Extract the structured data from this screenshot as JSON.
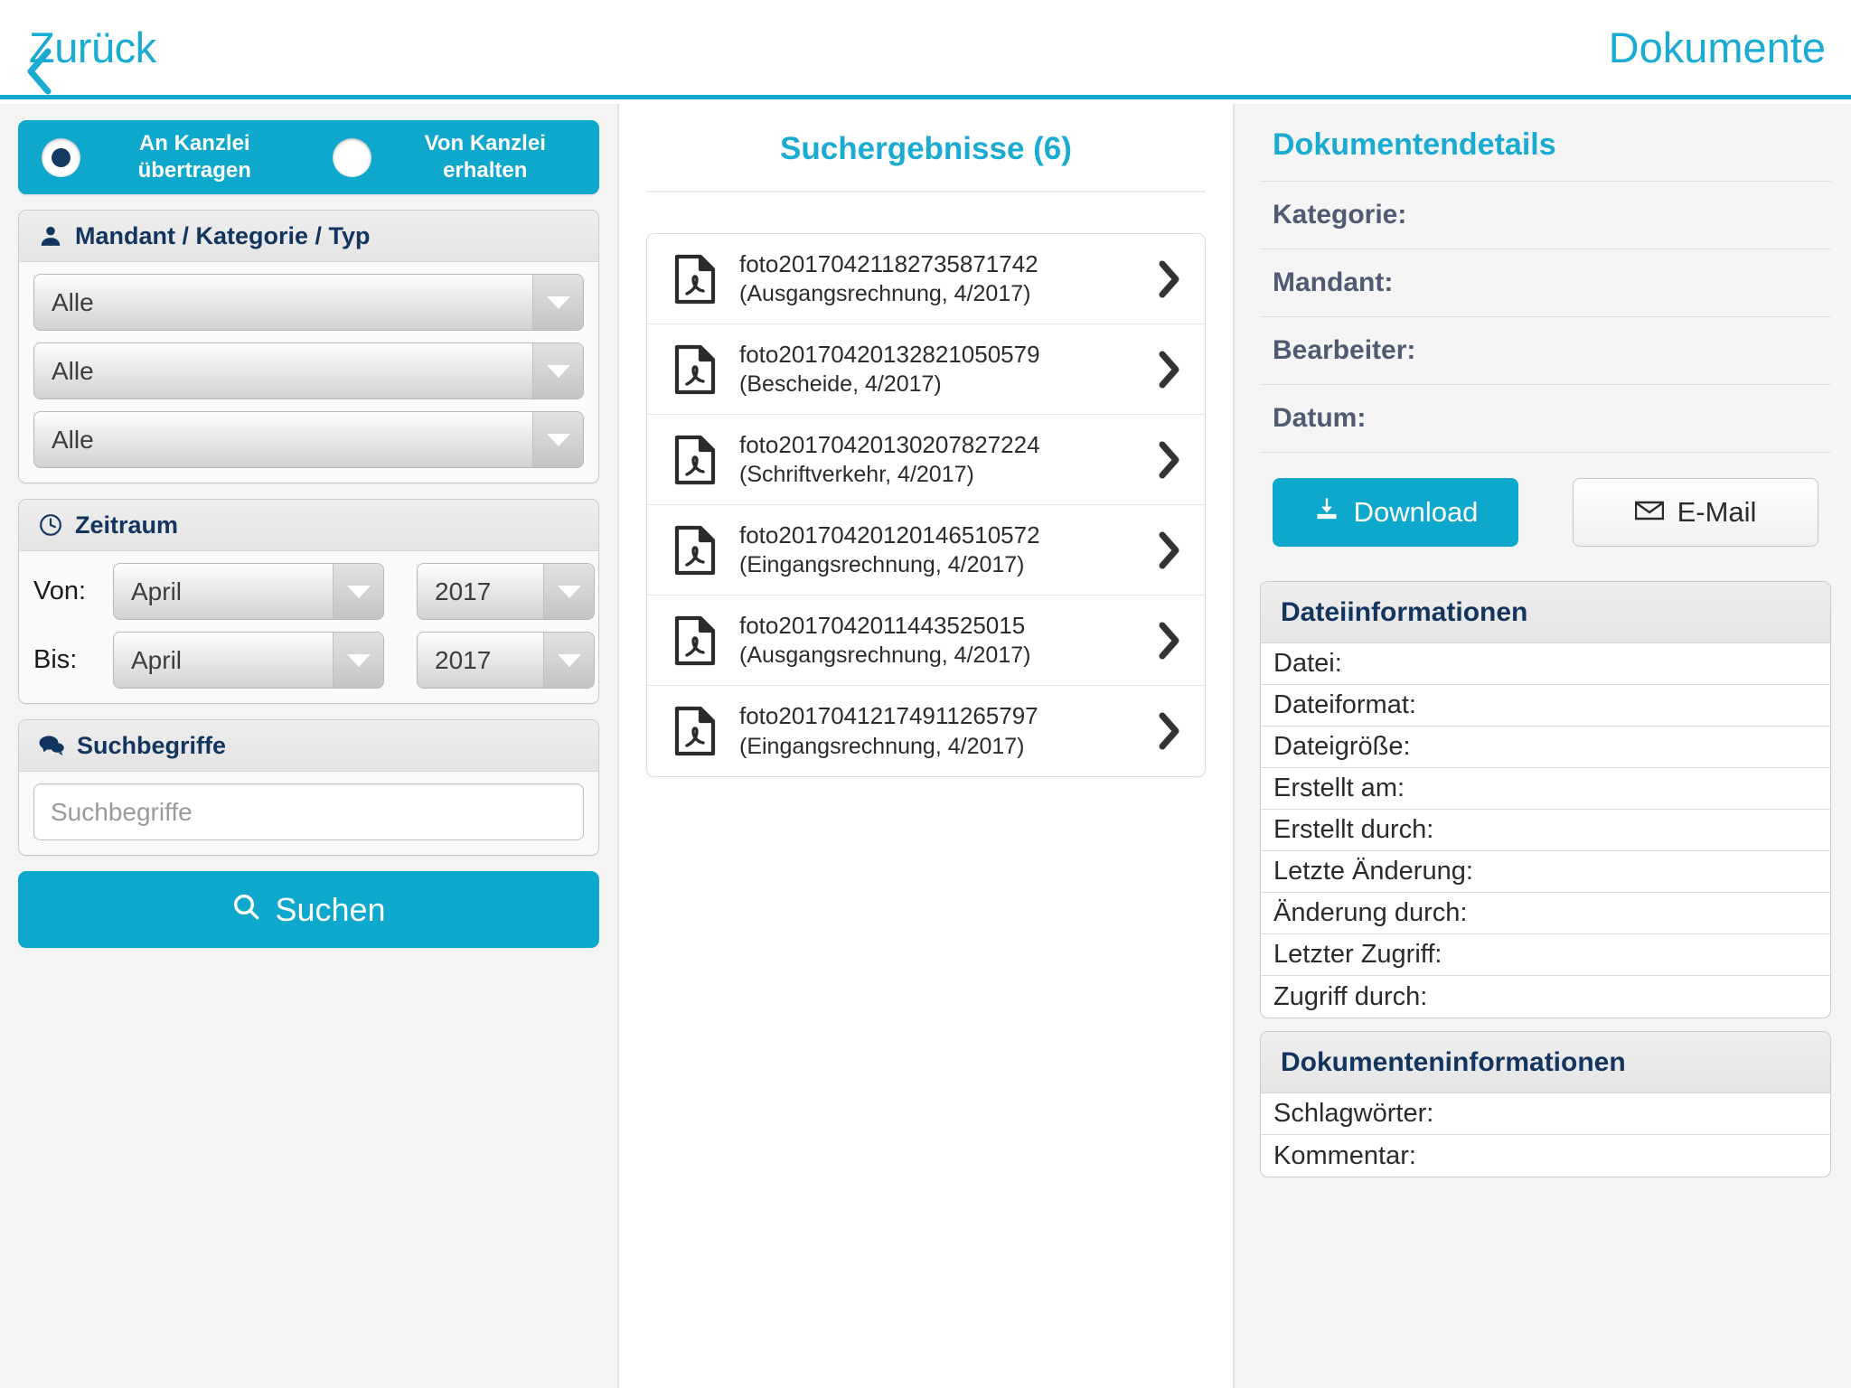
{
  "topbar": {
    "back_label": "Zurück",
    "title": "Dokumente",
    "accent_color": "#1aabd2"
  },
  "filters": {
    "transfer": {
      "options": [
        {
          "label_line1": "An Kanzlei",
          "label_line2": "übertragen",
          "selected": true
        },
        {
          "label_line1": "Von Kanzlei",
          "label_line2": "erhalten",
          "selected": false
        }
      ],
      "background_color": "#0fa8cd"
    },
    "mandant_section": {
      "title": "Mandant / Kategorie / Typ",
      "icon": "user-icon",
      "selects": [
        {
          "name": "mandant",
          "value": "Alle"
        },
        {
          "name": "kategorie",
          "value": "Alle"
        },
        {
          "name": "typ",
          "value": "Alle"
        }
      ]
    },
    "zeitraum_section": {
      "title": "Zeitraum",
      "icon": "clock-icon",
      "von_label": "Von:",
      "bis_label": "Bis:",
      "von_month": "April",
      "von_year": "2017",
      "bis_month": "April",
      "bis_year": "2017"
    },
    "suchbegriffe_section": {
      "title": "Suchbegriffe",
      "icon": "comments-icon",
      "input_value": "",
      "input_placeholder": "Suchbegriffe"
    },
    "search_button": {
      "label": "Suchen",
      "icon": "search-icon"
    }
  },
  "results": {
    "heading": "Suchergebnisse (6)",
    "count": 6,
    "items": [
      {
        "name": "foto20170421182735871742",
        "meta": "(Ausgangsrechnung, 4/2017)",
        "icon": "pdf-file-icon"
      },
      {
        "name": "foto20170420132821050579",
        "meta": "(Bescheide, 4/2017)",
        "icon": "pdf-file-icon"
      },
      {
        "name": "foto20170420130207827224",
        "meta": "(Schriftverkehr, 4/2017)",
        "icon": "pdf-file-icon"
      },
      {
        "name": "foto20170420120146510572",
        "meta": "(Eingangsrechnung, 4/2017)",
        "icon": "pdf-file-icon"
      },
      {
        "name": "foto2017042011443525015",
        "meta": "(Ausgangsrechnung, 4/2017)",
        "icon": "pdf-file-icon"
      },
      {
        "name": "foto20170412174911265797",
        "meta": "(Eingangsrechnung, 4/2017)",
        "icon": "pdf-file-icon"
      }
    ]
  },
  "details": {
    "title": "Dokumentendetails",
    "rows": [
      {
        "label": "Kategorie:",
        "value": ""
      },
      {
        "label": "Mandant:",
        "value": ""
      },
      {
        "label": "Bearbeiter:",
        "value": ""
      },
      {
        "label": "Datum:",
        "value": ""
      }
    ],
    "download_button": {
      "label": "Download",
      "icon": "download-icon"
    },
    "email_button": {
      "label": "E-Mail",
      "icon": "envelope-icon"
    },
    "file_info": {
      "title": "Dateiinformationen",
      "rows": [
        {
          "label": "Datei:",
          "value": ""
        },
        {
          "label": "Dateiformat:",
          "value": ""
        },
        {
          "label": "Dateigröße:",
          "value": ""
        },
        {
          "label": "Erstellt am:",
          "value": ""
        },
        {
          "label": "Erstellt durch:",
          "value": ""
        },
        {
          "label": "Letzte Änderung:",
          "value": ""
        },
        {
          "label": "Änderung durch:",
          "value": ""
        },
        {
          "label": "Letzter Zugriff:",
          "value": ""
        },
        {
          "label": "Zugriff durch:",
          "value": ""
        }
      ]
    },
    "document_info": {
      "title": "Dokumenteninformationen",
      "rows": [
        {
          "label": "Schlagwörter:",
          "value": ""
        },
        {
          "label": "Kommentar:",
          "value": ""
        }
      ]
    }
  }
}
